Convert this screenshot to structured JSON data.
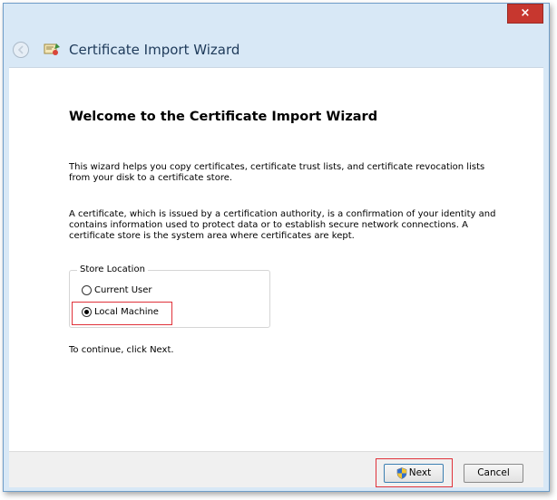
{
  "window": {
    "close_symbol": "×",
    "title": "Certificate Import Wizard",
    "icons": [
      "back-arrow-icon",
      "certificate-icon",
      "close-icon",
      "shield-icon"
    ]
  },
  "content": {
    "heading": "Welcome to the Certificate Import Wizard",
    "paragraph1": "This wizard helps you copy certificates, certificate trust lists, and certificate revocation lists from your disk to a certificate store.",
    "paragraph2": "A certificate, which is issued by a certification authority, is a confirmation of your identity and contains information used to protect data or to establish secure network connections. A certificate store is the system area where certificates are kept.",
    "store_location": {
      "legend": "Store Location",
      "options": [
        {
          "label": "Current User",
          "checked": false
        },
        {
          "label": "Local Machine",
          "checked": true
        }
      ]
    },
    "continue_text": "To continue, click Next."
  },
  "footer": {
    "next_label": "Next",
    "cancel_label": "Cancel"
  },
  "colors": {
    "frame": "#d8e8f6",
    "close_button": "#c7372f",
    "highlight": "#e0323a",
    "title_text": "#1e3a5a"
  }
}
